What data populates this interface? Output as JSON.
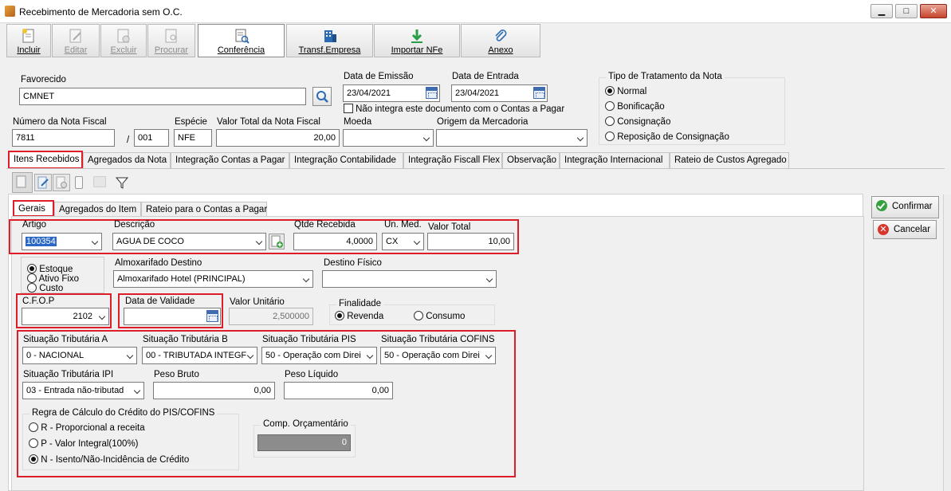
{
  "window": {
    "title": "Recebimento de Mercadoria sem O.C.",
    "controls": {
      "minimize": "▁",
      "maximize": "□",
      "close": "✕"
    }
  },
  "toolbar": {
    "incluir": "Incluir",
    "editar": "Editar",
    "excluir": "Excluir",
    "procurar": "Procurar",
    "conferencia": "Conferência",
    "transf": "Transf.Empresa",
    "importar": "Importar NFe",
    "anexo": "Anexo"
  },
  "header": {
    "favorecido_label": "Favorecido",
    "favorecido_value": "CMNET",
    "data_emissao_label": "Data de Emissão",
    "data_emissao_value": "23/04/2021",
    "data_entrada_label": "Data de Entrada",
    "data_entrada_value": "23/04/2021",
    "nao_integra_label": "Não integra este documento com o Contas a Pagar",
    "tipo_label": "Tipo de Tratamento da Nota",
    "tipo_options": [
      "Normal",
      "Bonificação",
      "Consignação",
      "Reposição de Consignação"
    ],
    "numero_label": "Número da Nota Fiscal",
    "numero_value": "7811",
    "serie_sep": "/",
    "serie_value": "001",
    "especie_label": "Espécie",
    "especie_value": "NFE",
    "valor_total_label": "Valor Total da Nota Fiscal",
    "valor_total_value": "20,00",
    "moeda_label": "Moeda",
    "moeda_value": "",
    "origem_label": "Origem da Mercadoria",
    "origem_value": ""
  },
  "tabs": [
    "Itens Recebidos",
    "Agregados da Nota",
    "Integração Contas a Pagar",
    "Integração Contabilidade",
    "Integração Fiscall Flex",
    "Observação",
    "Integração Internacional",
    "Rateio de Custos Agregado"
  ],
  "subtabs": [
    "Gerais",
    "Agregados do Item",
    "Rateio para o Contas a Pagar"
  ],
  "actions": {
    "confirmar": "Confirmar",
    "cancelar": "Cancelar"
  },
  "item": {
    "artigo_label": "Artigo",
    "artigo_value": "100354",
    "descricao_label": "Descrição",
    "descricao_value": "AGUA DE COCO",
    "qtde_label": "Qtde Recebida",
    "qtde_value": "4,0000",
    "unmed_label": "Un. Med.",
    "unmed_value": "CX",
    "valortotal_label": "Valor Total",
    "valortotal_value": "10,00",
    "destino_options": [
      "Estoque",
      "Ativo Fixo",
      "Custo"
    ],
    "almox_label": "Almoxarifado Destino",
    "almox_value": "Almoxarifado Hotel (PRINCIPAL)",
    "destino_fisico_label": "Destino Físico",
    "destino_fisico_value": "",
    "cfop_label": "C.F.O.P",
    "cfop_value": "2102",
    "validade_label": "Data de Validade",
    "validade_value": "",
    "valor_unit_label": "Valor Unitário",
    "valor_unit_value": "2,500000",
    "finalidade_label": "Finalidade",
    "finalidade_options": [
      "Revenda",
      "Consumo"
    ],
    "sit_a_label": "Situação Tributária A",
    "sit_a_value": "0  -  NACIONAL",
    "sit_b_label": "Situação Tributária B",
    "sit_b_value": "00  -  TRIBUTADA INTEGF",
    "sit_pis_label": "Situação Tributária PIS",
    "sit_pis_value": "50 - Operação com Direi",
    "sit_cofins_label": "Situação Tributária COFINS",
    "sit_cofins_value": "50 - Operação com Direi",
    "sit_ipi_label": "Situação Tributária IPI",
    "sit_ipi_value": "03 - Entrada não-tributad",
    "peso_bruto_label": "Peso Bruto",
    "peso_bruto_value": "0,00",
    "peso_liquido_label": "Peso Líquido",
    "peso_liquido_value": "0,00",
    "regra_label": "Regra de Cálculo do Crédito do PIS/COFINS",
    "regra_options": [
      "R - Proporcional a receita",
      "P - Valor Integral(100%)",
      "N - Isento/Não-Incidência de Crédito"
    ],
    "comp_label": "Comp. Orçamentário",
    "comp_value": "0"
  }
}
